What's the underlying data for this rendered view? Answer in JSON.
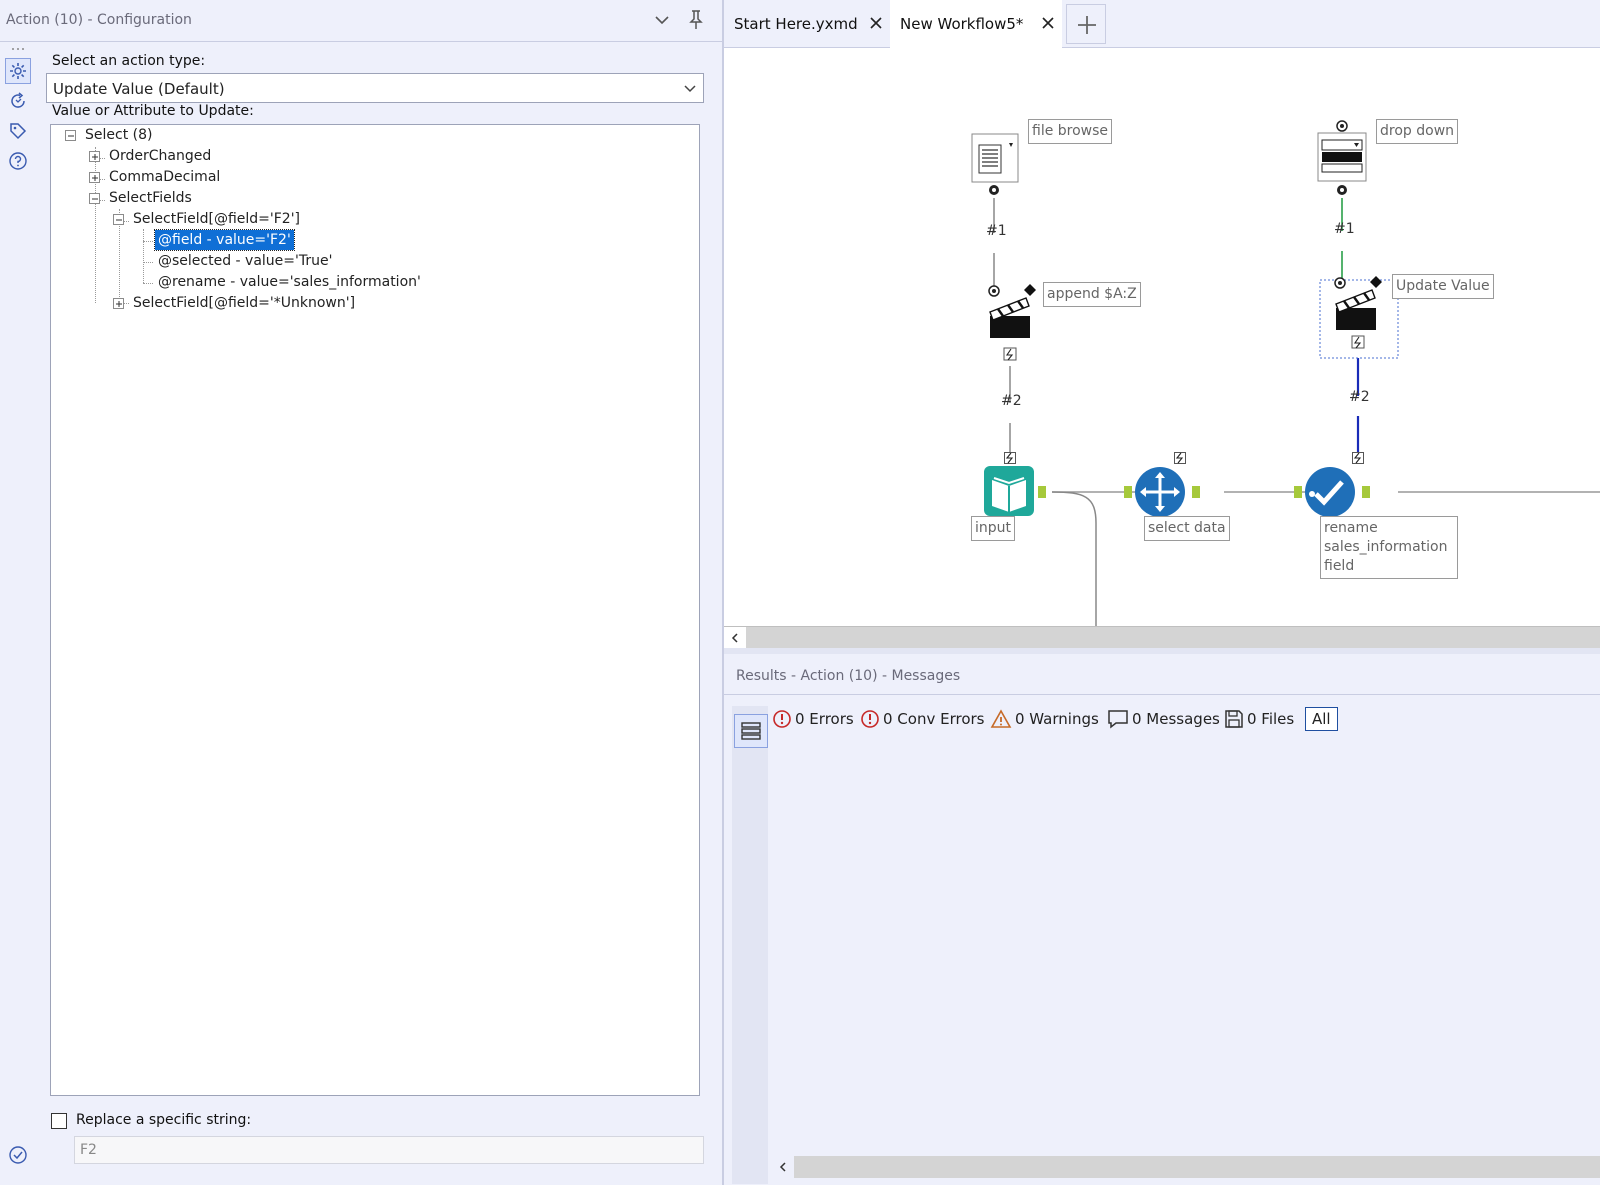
{
  "config": {
    "title": "Action (10) - Configuration",
    "action_type_label": "Select an action type:",
    "action_type_value": "Update Value (Default)",
    "value_attr_label": "Value or Attribute to Update:",
    "tree": {
      "root": "Select (8)",
      "order_changed": "OrderChanged",
      "comma_decimal": "CommaDecimal",
      "select_fields": "SelectFields",
      "select_field_f2": "SelectField[@field='F2']",
      "attr_field": "@field - value='F2'",
      "attr_selected": "@selected - value='True'",
      "attr_rename": "@rename - value='sales_information'",
      "select_field_unknown": "SelectField[@field='*Unknown']"
    },
    "replace_label": "Replace a specific string:",
    "replace_checked": false,
    "replace_value": "F2"
  },
  "tabs": [
    {
      "label": "Start Here.yxmd"
    },
    {
      "label": "New Workflow5*"
    }
  ],
  "canvas": {
    "nodes": {
      "file_browse": "file browse",
      "drop_down": "drop down",
      "append": "append $A:Z",
      "update_value": "Update Value",
      "input": "input",
      "select_data": "select data",
      "rename": "rename sales_information field"
    },
    "connections": {
      "left_q": "#1",
      "right_q": "#1",
      "left_action": "#2",
      "right_action": "#2"
    }
  },
  "results": {
    "title": "Results - Action (10) - Messages",
    "errors": "0 Errors",
    "conv_errors": "0 Conv Errors",
    "warnings": "0 Warnings",
    "messages": "0 Messages",
    "files": "0 Files",
    "all": "All"
  },
  "colors": {
    "accent": "#0f6fd6",
    "panel_bg": "#eef0fb",
    "teal_tool": "#1fa89a",
    "blue_tool": "#1f6fb8",
    "anchor_green": "#a6c93b",
    "update_wire": "#1a2bb8",
    "error_red": "#c62828"
  }
}
